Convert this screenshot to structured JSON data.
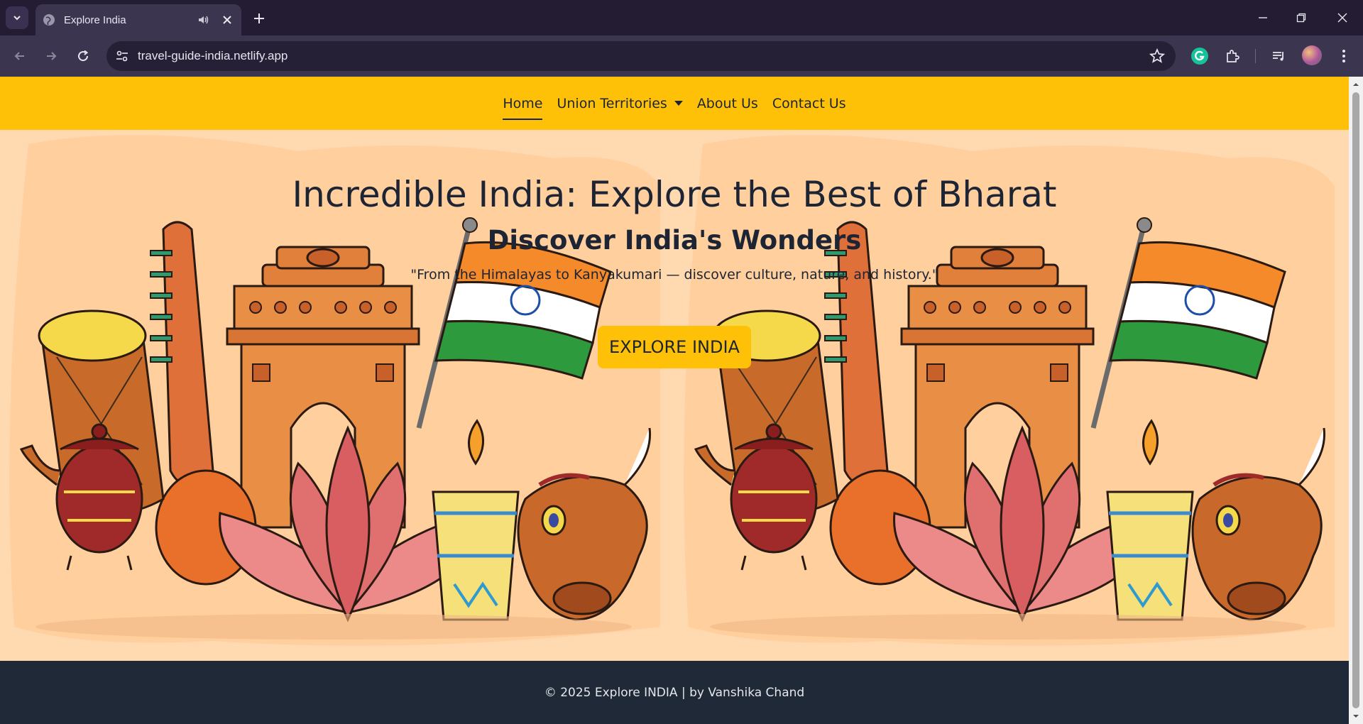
{
  "browser": {
    "tab_title": "Explore India",
    "url": "travel-guide-india.netlify.app"
  },
  "nav": {
    "items": [
      {
        "label": "Home",
        "active": true
      },
      {
        "label": "Union Territories",
        "dropdown": true
      },
      {
        "label": "About Us"
      },
      {
        "label": "Contact Us"
      }
    ]
  },
  "hero": {
    "title": "Incredible India: Explore the Best of Bharat",
    "subtitle": "Discover India's Wonders",
    "quote": "\"From the Himalayas to Kanyakumari — discover culture, nature, and history.\"",
    "cta_label": "EXPLORE INDIA"
  },
  "footer": {
    "text": "© 2025 Explore INDIA | by Vanshika Chand"
  },
  "colors": {
    "navbar": "#ffc107",
    "hero_bg": "#ffd9b0",
    "footer": "#1f2937",
    "text_dark": "#1d2433"
  },
  "icons": [
    "tab-search-icon",
    "globe-icon",
    "speaker-icon",
    "close-icon",
    "plus-icon",
    "minimize-icon",
    "restore-icon",
    "back-icon",
    "forward-icon",
    "reload-icon",
    "site-info-icon",
    "star-icon",
    "grammarly-icon",
    "extensions-icon",
    "media-icon",
    "menu-icon"
  ]
}
